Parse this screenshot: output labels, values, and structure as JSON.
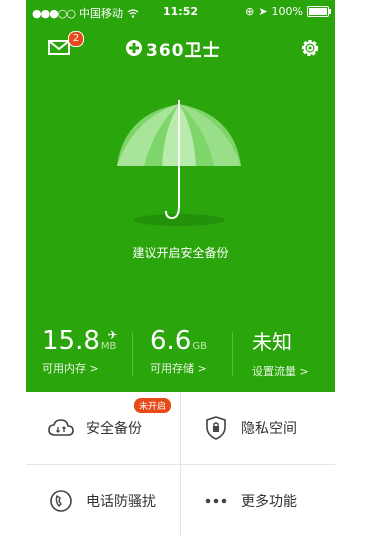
{
  "status_bar": {
    "carrier": "中国移动",
    "time": "11:52",
    "battery": "100%"
  },
  "header": {
    "badge_count": "2",
    "logo_text": "360卫士"
  },
  "main": {
    "hint": "建议开启安全备份"
  },
  "stats": [
    {
      "value": "15.8",
      "unit": "MB",
      "label": "可用内存 >"
    },
    {
      "value": "6.6",
      "unit": "GB",
      "label": "可用存储 >"
    },
    {
      "value": "未知",
      "unit": "",
      "label": "设置流量 >"
    }
  ],
  "grid": {
    "items": [
      {
        "label": "安全备份",
        "tag": "未开启",
        "icon": "cloud-icon"
      },
      {
        "label": "隐私空间",
        "icon": "shield-lock-icon"
      },
      {
        "label": "电话防骚扰",
        "icon": "phone-guard-icon"
      },
      {
        "label": "更多功能",
        "icon": "more-dots-icon"
      }
    ]
  },
  "colors": {
    "primary_green": "#2ba50c",
    "badge_red": "#e64a19"
  }
}
